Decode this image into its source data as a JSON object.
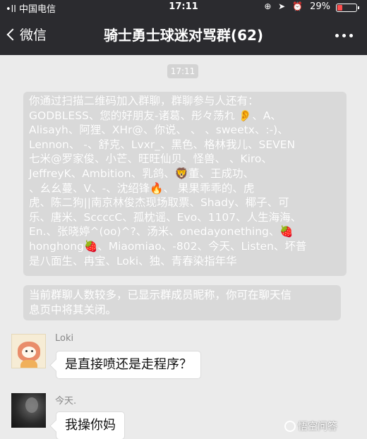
{
  "status_bar": {
    "carrier": "•ll 中国电信",
    "time": "17:11",
    "icons": "⊕ ➤ ⏰",
    "battery": "29%",
    "battery_level": 0.29
  },
  "nav": {
    "back_label": "微信",
    "title": "骑士勇士球迷对骂群(62)"
  },
  "chat": {
    "timestamp": "17:11",
    "system_lines": [
      "你通过扫描二维码加入群聊，群聊参与人还有：",
      "GODBLESS、您的好朋友-诸葛、彤々荡れ 👂、A、",
      "Alisayh、阿狸、XHr@、你说、 、 、sweetx、:-)、",
      "Lennon、 -、舒克、Lvxr_、黑色、格林我儿、SEVEN",
      "七米@罗家俊、小芒、旺旺仙贝、怪兽、 、Kiro、",
      "JeffreyK、Ambition、乳鸽、🦁董、王成功、",
      "   、幺幺蔓、V、-、沈绍锋🔥、 果果乖乖的、虎",
      "虎、陈二狗||南京林俊杰现场取票、Shady、椰子、可",
      "乐、唐米、SccccC、孤枕谣、Evo、1107、人生海海、",
      "En.、张晓婷^(oo)^?、汤米、onedayonething、🍓",
      "honghong🍓、Miaomiao、-802、今天、Listen、坏普",
      "是八面生、冉宝、Loki、独、青春染指年华"
    ],
    "notice": "当前群聊人数较多，已显示群成员昵称，你可在聊天信\n息页中将其关闭。",
    "messages": [
      {
        "sender": "Loki",
        "text": "是直接喷还是走程序？"
      },
      {
        "sender": "今天.",
        "text": "我操你妈"
      }
    ]
  },
  "watermark": "悟空问答"
}
